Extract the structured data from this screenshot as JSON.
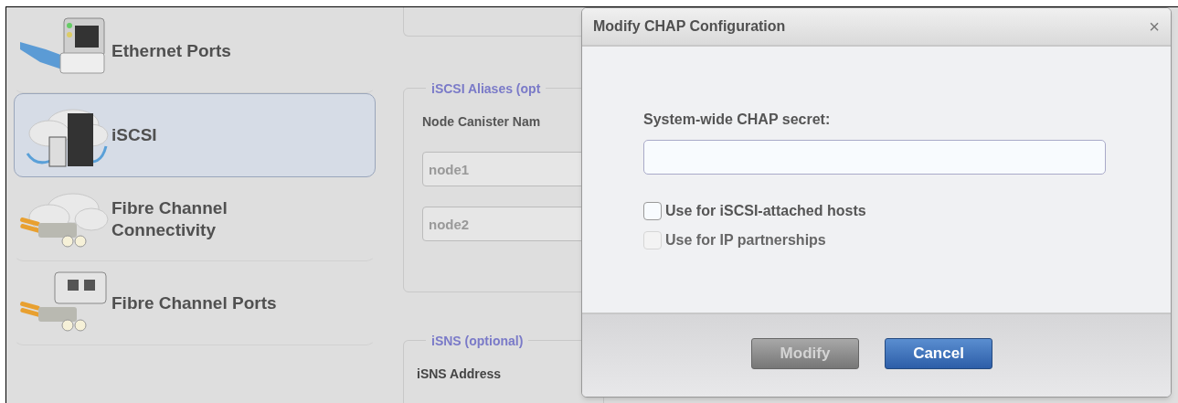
{
  "sidebar": {
    "items": [
      {
        "label": "Ethernet Ports",
        "selected": false
      },
      {
        "label": "iSCSI",
        "selected": true
      },
      {
        "label": "Fibre Channel Connectivity",
        "selected": false
      },
      {
        "label": "Fibre Channel Ports",
        "selected": false
      }
    ]
  },
  "content": {
    "aliases": {
      "legend": "iSCSI Aliases (opt",
      "column_header": "Node Canister Nam",
      "fields": [
        {
          "value": "node1"
        },
        {
          "value": "node2"
        }
      ]
    },
    "isns": {
      "legend": "iSNS (optional)",
      "label": "iSNS Address"
    }
  },
  "dialog": {
    "title": "Modify CHAP Configuration",
    "close": "×",
    "secret_label": "System-wide CHAP secret:",
    "checkboxes": [
      {
        "label": "Use for iSCSI-attached hosts",
        "checked": false,
        "disabled": false
      },
      {
        "label": "Use for IP partnerships",
        "checked": false,
        "disabled": true
      }
    ],
    "buttons": [
      {
        "label": "Modify",
        "kind": "secondary",
        "disabled": true
      },
      {
        "label": "Cancel",
        "kind": "primary",
        "disabled": false
      }
    ]
  }
}
